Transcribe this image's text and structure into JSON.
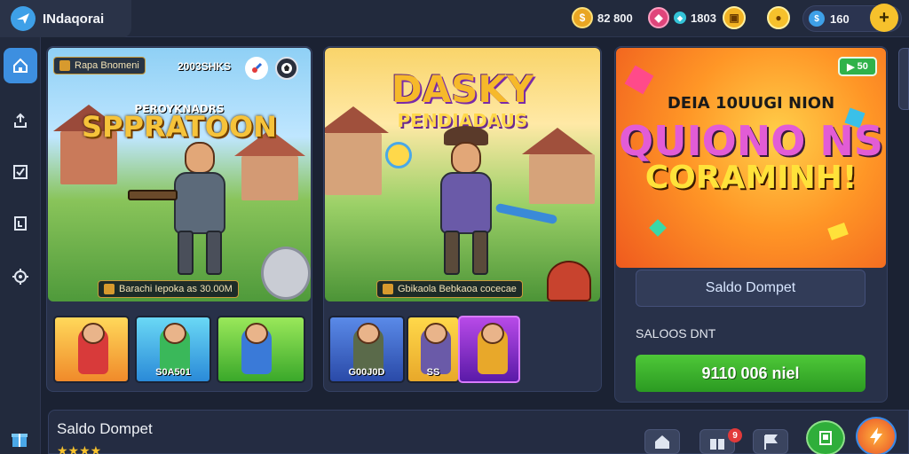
{
  "app": {
    "name": "INdaqorai",
    "logo_icon": "plane-icon"
  },
  "topbar": {
    "coins": [
      {
        "icon": "gold-coin-icon",
        "value": "82 800",
        "color": "#e9a623"
      },
      {
        "icon": "gem-icon",
        "value": "1803",
        "color": "#e0457b"
      },
      {
        "icon": "chest-icon",
        "value": "",
        "color": "#f2b323"
      }
    ],
    "wallet_value": "160",
    "wallet_icon": "blue-coin-icon",
    "add_label": "+"
  },
  "sidebar": {
    "items": [
      {
        "icon": "home-icon",
        "active": true
      },
      {
        "icon": "upload-icon",
        "active": false
      },
      {
        "icon": "checklist-icon",
        "active": false
      },
      {
        "icon": "ranking-icon",
        "active": false
      },
      {
        "icon": "settings-icon",
        "active": false
      }
    ]
  },
  "banners": [
    {
      "subtitle": "PEROYKNADRS",
      "title": "SPPRATOON",
      "chip_left": "Rapa Bnomeni",
      "chip_right": "2003SHKS",
      "footer_chip": "Barachi Iepoka as 30.00M"
    },
    {
      "title": "DASKY",
      "subtitle": "PENDIADAUS",
      "footer_chip": "Gbikaola Bebkaoa cocecae"
    },
    {
      "line1": "DEIA 10UUGI NION",
      "line2": "QUIONO NS",
      "line3": "CORAMINH!",
      "badge": "50"
    }
  ],
  "thumbs_left": [
    {
      "label": ""
    },
    {
      "label": "S0A501"
    },
    {
      "label": ""
    }
  ],
  "thumbs_mid": [
    {
      "label": "G00J0D"
    },
    {
      "label": "SS"
    },
    {
      "label": ""
    }
  ],
  "wallet_panel": {
    "saldo_label": "Saldo Dompet",
    "saldo_caption": "SALOOS DNT",
    "action_label": "9110 006 niel"
  },
  "bottom": {
    "title": "Saldo Dompet",
    "stars": "★★★★",
    "notification_count": "9",
    "buttons": [
      "house-icon",
      "gift-icon",
      "flag-icon",
      "book-icon",
      "energy-icon"
    ]
  }
}
